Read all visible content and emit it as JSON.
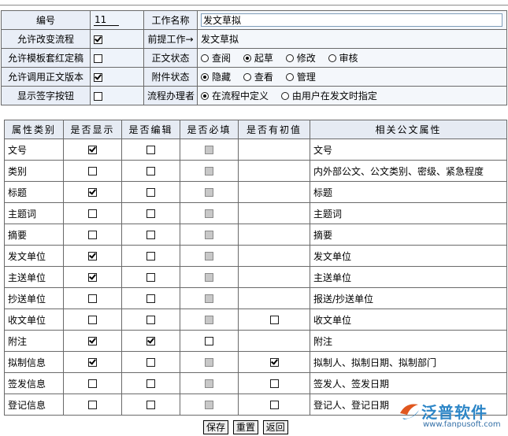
{
  "settings": {
    "number_label": "编号",
    "number_value": "11",
    "work_name_label": "工作名称",
    "work_name_value": "发文草拟",
    "allow_flow_change_label": "允许改变流程",
    "allow_flow_change_checked": true,
    "prev_work_label": "前提工作→",
    "prev_work_value": "发文草拟",
    "allow_template_label": "允许模板套红定稿",
    "allow_template_checked": false,
    "doc_status_label": "正文状态",
    "doc_status_options": [
      {
        "label": "查阅",
        "checked": false
      },
      {
        "label": "起草",
        "checked": true
      },
      {
        "label": "修改",
        "checked": false
      },
      {
        "label": "审核",
        "checked": false
      }
    ],
    "allow_doc_version_label": "允许调用正文版本",
    "allow_doc_version_checked": true,
    "attach_status_label": "附件状态",
    "attach_status_options": [
      {
        "label": "隐藏",
        "checked": true
      },
      {
        "label": "查看",
        "checked": false
      },
      {
        "label": "管理",
        "checked": false
      }
    ],
    "show_sign_label": "显示签字按钮",
    "show_sign_checked": false,
    "handler_label": "流程办理者",
    "handler_options": [
      {
        "label": "在流程中定义",
        "checked": true
      },
      {
        "label": "由用户在发文时指定",
        "checked": false
      }
    ]
  },
  "props_table": {
    "headers": [
      "属性类别",
      "是否显示",
      "是否编辑",
      "是否必填",
      "是否有初值",
      "相关公文属性"
    ],
    "rows": [
      {
        "category": "文号",
        "show": true,
        "edit": false,
        "required": false,
        "required_disabled": true,
        "initial": null,
        "related": "文号"
      },
      {
        "category": "类别",
        "show": false,
        "edit": false,
        "required": false,
        "required_disabled": true,
        "initial": null,
        "related": "内外部公文、公文类别、密级、紧急程度"
      },
      {
        "category": "标题",
        "show": true,
        "edit": false,
        "required": false,
        "required_disabled": true,
        "initial": null,
        "related": "标题"
      },
      {
        "category": "主题词",
        "show": false,
        "edit": false,
        "required": false,
        "required_disabled": true,
        "initial": null,
        "related": "主题词"
      },
      {
        "category": "摘要",
        "show": false,
        "edit": false,
        "required": false,
        "required_disabled": true,
        "initial": null,
        "related": "摘要"
      },
      {
        "category": "发文单位",
        "show": true,
        "edit": false,
        "required": false,
        "required_disabled": true,
        "initial": null,
        "related": "发文单位"
      },
      {
        "category": "主送单位",
        "show": true,
        "edit": false,
        "required": false,
        "required_disabled": true,
        "initial": null,
        "related": "主送单位"
      },
      {
        "category": "抄送单位",
        "show": false,
        "edit": false,
        "required": false,
        "required_disabled": true,
        "initial": null,
        "related": "报送/抄送单位"
      },
      {
        "category": "收文单位",
        "show": false,
        "edit": false,
        "required": false,
        "required_disabled": true,
        "initial": false,
        "related": "收文单位"
      },
      {
        "category": "附注",
        "show": true,
        "edit": true,
        "required": false,
        "required_disabled": false,
        "initial": null,
        "related": "附注"
      },
      {
        "category": "拟制信息",
        "show": true,
        "edit": false,
        "required": false,
        "required_disabled": true,
        "initial": true,
        "related": "拟制人、拟制日期、拟制部门"
      },
      {
        "category": "签发信息",
        "show": false,
        "edit": false,
        "required": false,
        "required_disabled": true,
        "initial": false,
        "related": "签发人、签发日期"
      },
      {
        "category": "登记信息",
        "show": false,
        "edit": false,
        "required": false,
        "required_disabled": true,
        "initial": false,
        "related": "登记人、登记日期"
      }
    ]
  },
  "buttons": {
    "save": "保存",
    "reset": "重置",
    "back": "返回"
  },
  "watermark": {
    "brand": "泛普软件",
    "url": "www.fanpusoft.com"
  },
  "colors": {
    "label_bg": "#e9eef7",
    "header_bg": "#e6ebf3",
    "brand": "#2d86c7"
  }
}
